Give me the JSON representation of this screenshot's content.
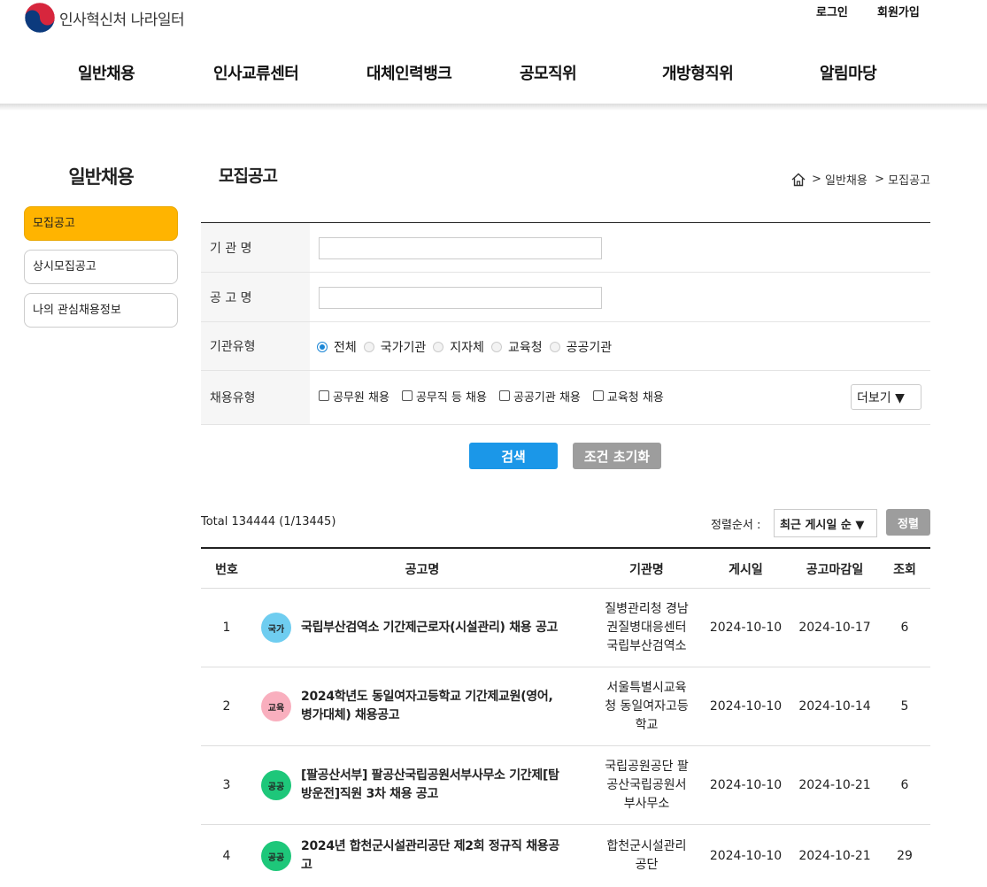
{
  "header": {
    "logo_text": "인사혁신처 나라일터",
    "util": {
      "login": "로그인",
      "join": "회원가입"
    },
    "gnb": [
      "일반채용",
      "인사교류센터",
      "대체인력뱅크",
      "공모직위",
      "개방형직위",
      "알림마당"
    ]
  },
  "sidebar": {
    "title": "일반채용",
    "items": [
      {
        "label": "모집공고",
        "active": true
      },
      {
        "label": "상시모집공고",
        "active": false
      },
      {
        "label": "나의 관심채용정보",
        "active": false
      }
    ]
  },
  "main": {
    "title": "모집공고",
    "breadcrumb": [
      "일반채용",
      "모집공고"
    ],
    "breadcrumb_sep": ">",
    "form": {
      "org_label": "기 관 명",
      "org_value": "",
      "notice_label": "공 고 명",
      "notice_value": "",
      "org_type_label": "기관유형",
      "org_types": [
        "전체",
        "국가기관",
        "지자체",
        "교육청",
        "공공기관"
      ],
      "org_type_selected": "전체",
      "hire_type_label": "채용유형",
      "hire_types": [
        "공무원 채용",
        "공무직 등 채용",
        "공공기관 채용",
        "교육청 채용"
      ],
      "more_label": "더보기 ▼"
    },
    "buttons": {
      "search": "검색",
      "reset": "조건 초기화"
    },
    "list": {
      "total": "Total 134444 (1/13445)",
      "sort_label": "정렬순서 :",
      "sort_value": "최근 게시일 순 ▼",
      "sort_button": "정렬",
      "headers": [
        "번호",
        "공고명",
        "기관명",
        "게시일",
        "공고마감일",
        "조회"
      ],
      "rows": [
        {
          "no": "1",
          "badge": "국가",
          "badge_color": "#6fcdf0",
          "title_lines": [
            "국립부산검역소 기간제근로자(시설관리) 채용 공고"
          ],
          "org_lines": [
            "질병관리청 경남",
            "권질병대응센터",
            "국립부산검역소"
          ],
          "posted": "2024-10-10",
          "deadline": "2024-10-17",
          "views": "6"
        },
        {
          "no": "2",
          "badge": "교육",
          "badge_color": "#f9afbe",
          "title_lines": [
            "2024학년도 동일여자고등학교 기간제교원(영어,",
            "병가대체) 채용공고"
          ],
          "org_lines": [
            "서울특별시교육",
            "청 동일여자고등",
            "학교"
          ],
          "posted": "2024-10-10",
          "deadline": "2024-10-14",
          "views": "5"
        },
        {
          "no": "3",
          "badge": "공공",
          "badge_color": "#1ec77a",
          "title_lines": [
            "[팔공산서부] 팔공산국립공원서부사무소 기간제[탐",
            "방운전]직원 3차 채용 공고"
          ],
          "org_lines": [
            "국립공원공단 팔",
            "공산국립공원서",
            "부사무소"
          ],
          "posted": "2024-10-10",
          "deadline": "2024-10-21",
          "views": "6"
        },
        {
          "no": "4",
          "badge": "공공",
          "badge_color": "#1ec77a",
          "title_lines": [
            "2024년 합천군시설관리공단 제2회 정규직 채용공",
            "고"
          ],
          "org_lines": [
            "합천군시설관리",
            "공단"
          ],
          "posted": "2024-10-10",
          "deadline": "2024-10-21",
          "views": "29"
        }
      ]
    }
  }
}
